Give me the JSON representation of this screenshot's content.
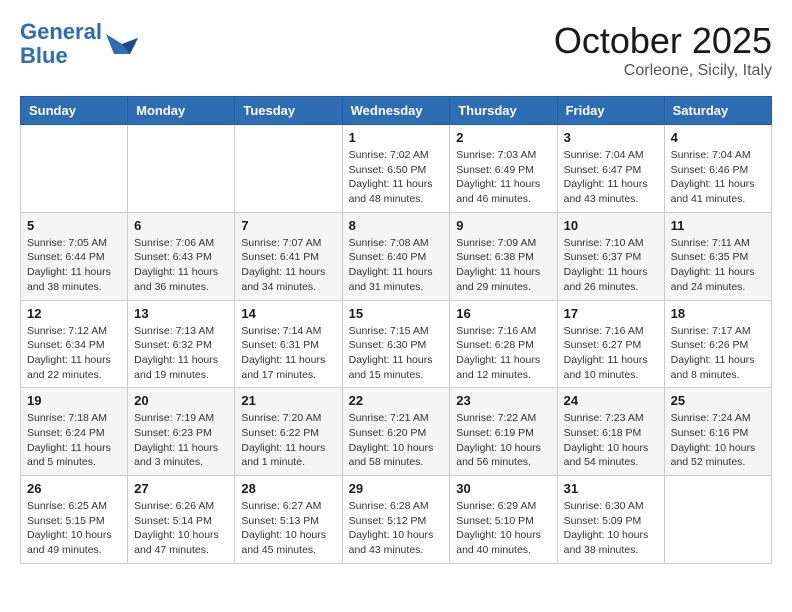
{
  "header": {
    "logo_line1": "General",
    "logo_line2": "Blue",
    "month": "October 2025",
    "location": "Corleone, Sicily, Italy"
  },
  "weekdays": [
    "Sunday",
    "Monday",
    "Tuesday",
    "Wednesday",
    "Thursday",
    "Friday",
    "Saturday"
  ],
  "weeks": [
    [
      {
        "day": "",
        "info": ""
      },
      {
        "day": "",
        "info": ""
      },
      {
        "day": "",
        "info": ""
      },
      {
        "day": "1",
        "info": "Sunrise: 7:02 AM\nSunset: 6:50 PM\nDaylight: 11 hours and 48 minutes."
      },
      {
        "day": "2",
        "info": "Sunrise: 7:03 AM\nSunset: 6:49 PM\nDaylight: 11 hours and 46 minutes."
      },
      {
        "day": "3",
        "info": "Sunrise: 7:04 AM\nSunset: 6:47 PM\nDaylight: 11 hours and 43 minutes."
      },
      {
        "day": "4",
        "info": "Sunrise: 7:04 AM\nSunset: 6:46 PM\nDaylight: 11 hours and 41 minutes."
      }
    ],
    [
      {
        "day": "5",
        "info": "Sunrise: 7:05 AM\nSunset: 6:44 PM\nDaylight: 11 hours and 38 minutes."
      },
      {
        "day": "6",
        "info": "Sunrise: 7:06 AM\nSunset: 6:43 PM\nDaylight: 11 hours and 36 minutes."
      },
      {
        "day": "7",
        "info": "Sunrise: 7:07 AM\nSunset: 6:41 PM\nDaylight: 11 hours and 34 minutes."
      },
      {
        "day": "8",
        "info": "Sunrise: 7:08 AM\nSunset: 6:40 PM\nDaylight: 11 hours and 31 minutes."
      },
      {
        "day": "9",
        "info": "Sunrise: 7:09 AM\nSunset: 6:38 PM\nDaylight: 11 hours and 29 minutes."
      },
      {
        "day": "10",
        "info": "Sunrise: 7:10 AM\nSunset: 6:37 PM\nDaylight: 11 hours and 26 minutes."
      },
      {
        "day": "11",
        "info": "Sunrise: 7:11 AM\nSunset: 6:35 PM\nDaylight: 11 hours and 24 minutes."
      }
    ],
    [
      {
        "day": "12",
        "info": "Sunrise: 7:12 AM\nSunset: 6:34 PM\nDaylight: 11 hours and 22 minutes."
      },
      {
        "day": "13",
        "info": "Sunrise: 7:13 AM\nSunset: 6:32 PM\nDaylight: 11 hours and 19 minutes."
      },
      {
        "day": "14",
        "info": "Sunrise: 7:14 AM\nSunset: 6:31 PM\nDaylight: 11 hours and 17 minutes."
      },
      {
        "day": "15",
        "info": "Sunrise: 7:15 AM\nSunset: 6:30 PM\nDaylight: 11 hours and 15 minutes."
      },
      {
        "day": "16",
        "info": "Sunrise: 7:16 AM\nSunset: 6:28 PM\nDaylight: 11 hours and 12 minutes."
      },
      {
        "day": "17",
        "info": "Sunrise: 7:16 AM\nSunset: 6:27 PM\nDaylight: 11 hours and 10 minutes."
      },
      {
        "day": "18",
        "info": "Sunrise: 7:17 AM\nSunset: 6:26 PM\nDaylight: 11 hours and 8 minutes."
      }
    ],
    [
      {
        "day": "19",
        "info": "Sunrise: 7:18 AM\nSunset: 6:24 PM\nDaylight: 11 hours and 5 minutes."
      },
      {
        "day": "20",
        "info": "Sunrise: 7:19 AM\nSunset: 6:23 PM\nDaylight: 11 hours and 3 minutes."
      },
      {
        "day": "21",
        "info": "Sunrise: 7:20 AM\nSunset: 6:22 PM\nDaylight: 11 hours and 1 minute."
      },
      {
        "day": "22",
        "info": "Sunrise: 7:21 AM\nSunset: 6:20 PM\nDaylight: 10 hours and 58 minutes."
      },
      {
        "day": "23",
        "info": "Sunrise: 7:22 AM\nSunset: 6:19 PM\nDaylight: 10 hours and 56 minutes."
      },
      {
        "day": "24",
        "info": "Sunrise: 7:23 AM\nSunset: 6:18 PM\nDaylight: 10 hours and 54 minutes."
      },
      {
        "day": "25",
        "info": "Sunrise: 7:24 AM\nSunset: 6:16 PM\nDaylight: 10 hours and 52 minutes."
      }
    ],
    [
      {
        "day": "26",
        "info": "Sunrise: 6:25 AM\nSunset: 5:15 PM\nDaylight: 10 hours and 49 minutes."
      },
      {
        "day": "27",
        "info": "Sunrise: 6:26 AM\nSunset: 5:14 PM\nDaylight: 10 hours and 47 minutes."
      },
      {
        "day": "28",
        "info": "Sunrise: 6:27 AM\nSunset: 5:13 PM\nDaylight: 10 hours and 45 minutes."
      },
      {
        "day": "29",
        "info": "Sunrise: 6:28 AM\nSunset: 5:12 PM\nDaylight: 10 hours and 43 minutes."
      },
      {
        "day": "30",
        "info": "Sunrise: 6:29 AM\nSunset: 5:10 PM\nDaylight: 10 hours and 40 minutes."
      },
      {
        "day": "31",
        "info": "Sunrise: 6:30 AM\nSunset: 5:09 PM\nDaylight: 10 hours and 38 minutes."
      },
      {
        "day": "",
        "info": ""
      }
    ]
  ]
}
